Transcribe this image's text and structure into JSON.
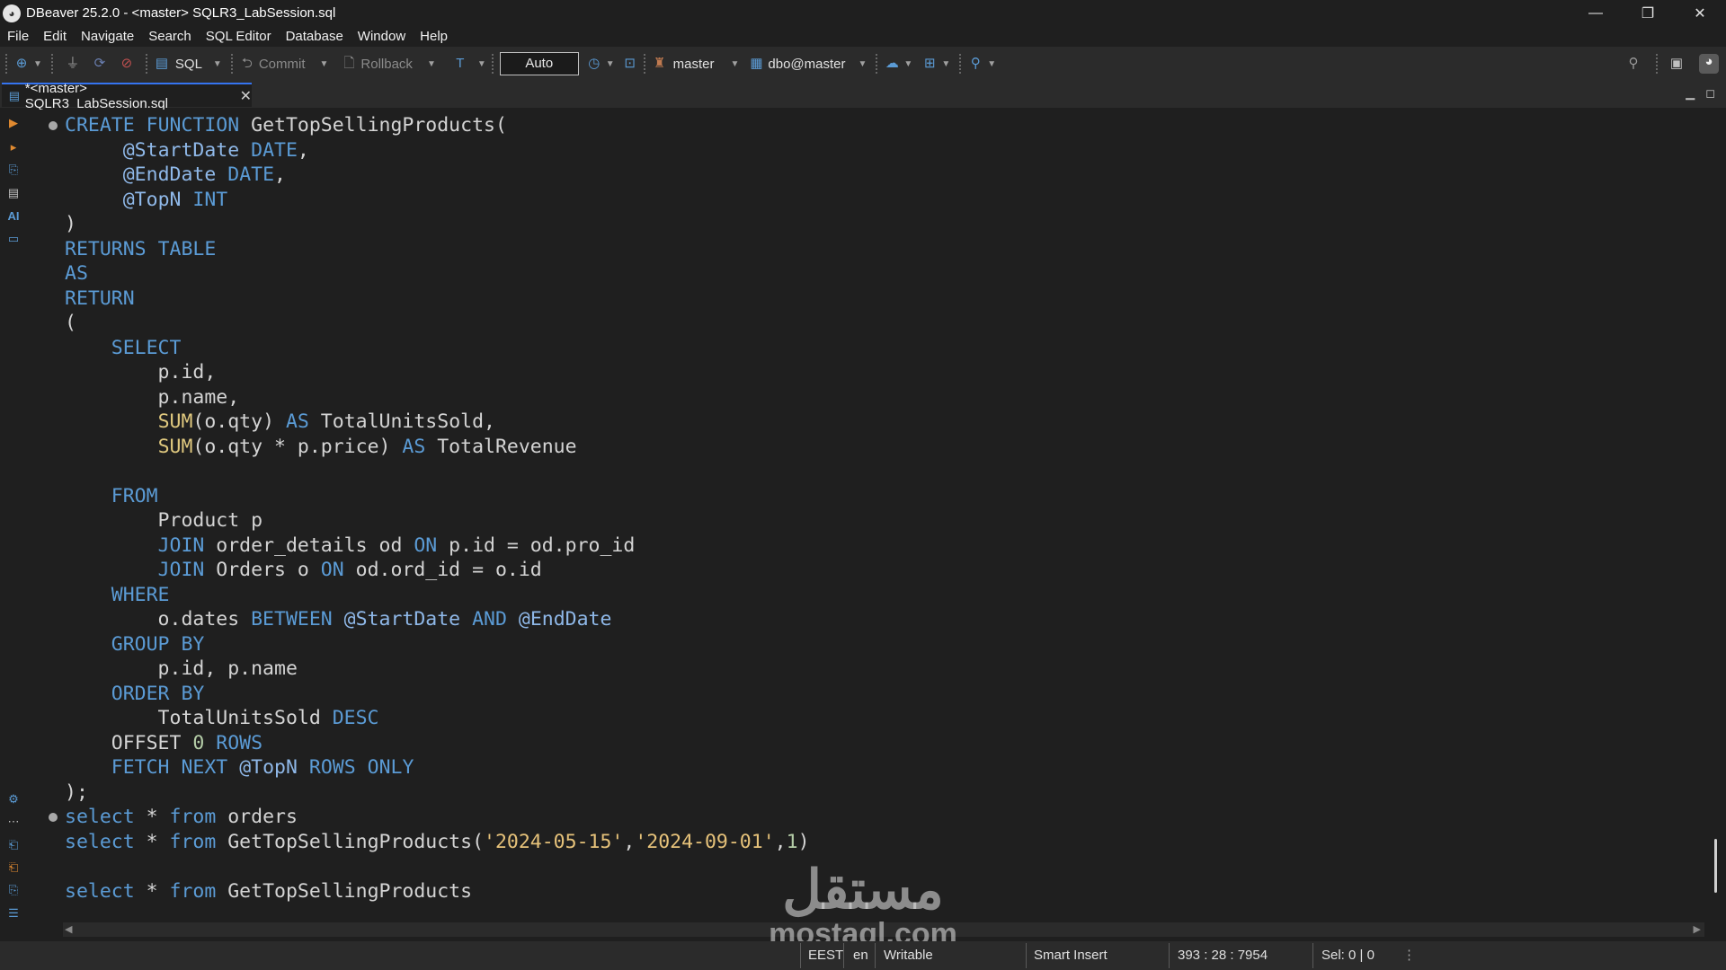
{
  "window": {
    "title": "DBeaver 25.2.0 - <master> SQLR3_LabSession.sql",
    "controls": {
      "minimize": "—",
      "restore": "❐",
      "close": "✕"
    }
  },
  "menu": [
    "File",
    "Edit",
    "Navigate",
    "Search",
    "SQL Editor",
    "Database",
    "Window",
    "Help"
  ],
  "toolbar": {
    "sql_label": "SQL",
    "commit_label": "Commit",
    "rollback_label": "Rollback",
    "transaction_mode": "Auto",
    "datasource": "master",
    "schema": "dbo@master"
  },
  "editor_tab": {
    "label": "*<master> SQLR3_LabSession.sql",
    "close": "✕"
  },
  "code": [
    "●CREATE FUNCTION GetTopSellingProducts(",
    "     @StartDate DATE,",
    "     @EndDate DATE,",
    "     @TopN INT",
    ")",
    "RETURNS TABLE",
    "AS",
    "RETURN",
    "(",
    "    SELECT",
    "        p.id,",
    "        p.name,",
    "        SUM(o.qty) AS TotalUnitsSold,",
    "        SUM(o.qty * p.price) AS TotalRevenue",
    "",
    "    FROM",
    "        Product p",
    "        JOIN order_details od ON p.id = od.pro_id",
    "        JOIN Orders o ON od.ord_id = o.id",
    "    WHERE",
    "        o.dates BETWEEN @StartDate AND @EndDate",
    "    GROUP BY",
    "        p.id, p.name",
    "    ORDER BY",
    "        TotalUnitsSold DESC",
    "    OFFSET 0 ROWS",
    "    FETCH NEXT @TopN ROWS ONLY",
    ");",
    "●select * from orders",
    "select * from GetTopSellingProducts('2024-05-15','2024-09-01',1)",
    "",
    "select * from GetTopSellingProducts"
  ],
  "watermark": {
    "arabic": "مستقل",
    "latin": "mostaql.com"
  },
  "status": {
    "timezone": "EEST",
    "locale": "en",
    "mode": "Writable",
    "insert_mode": "Smart Insert",
    "cursor_position": "393 : 28 : 7954",
    "selection": "Sel: 0 | 0"
  }
}
